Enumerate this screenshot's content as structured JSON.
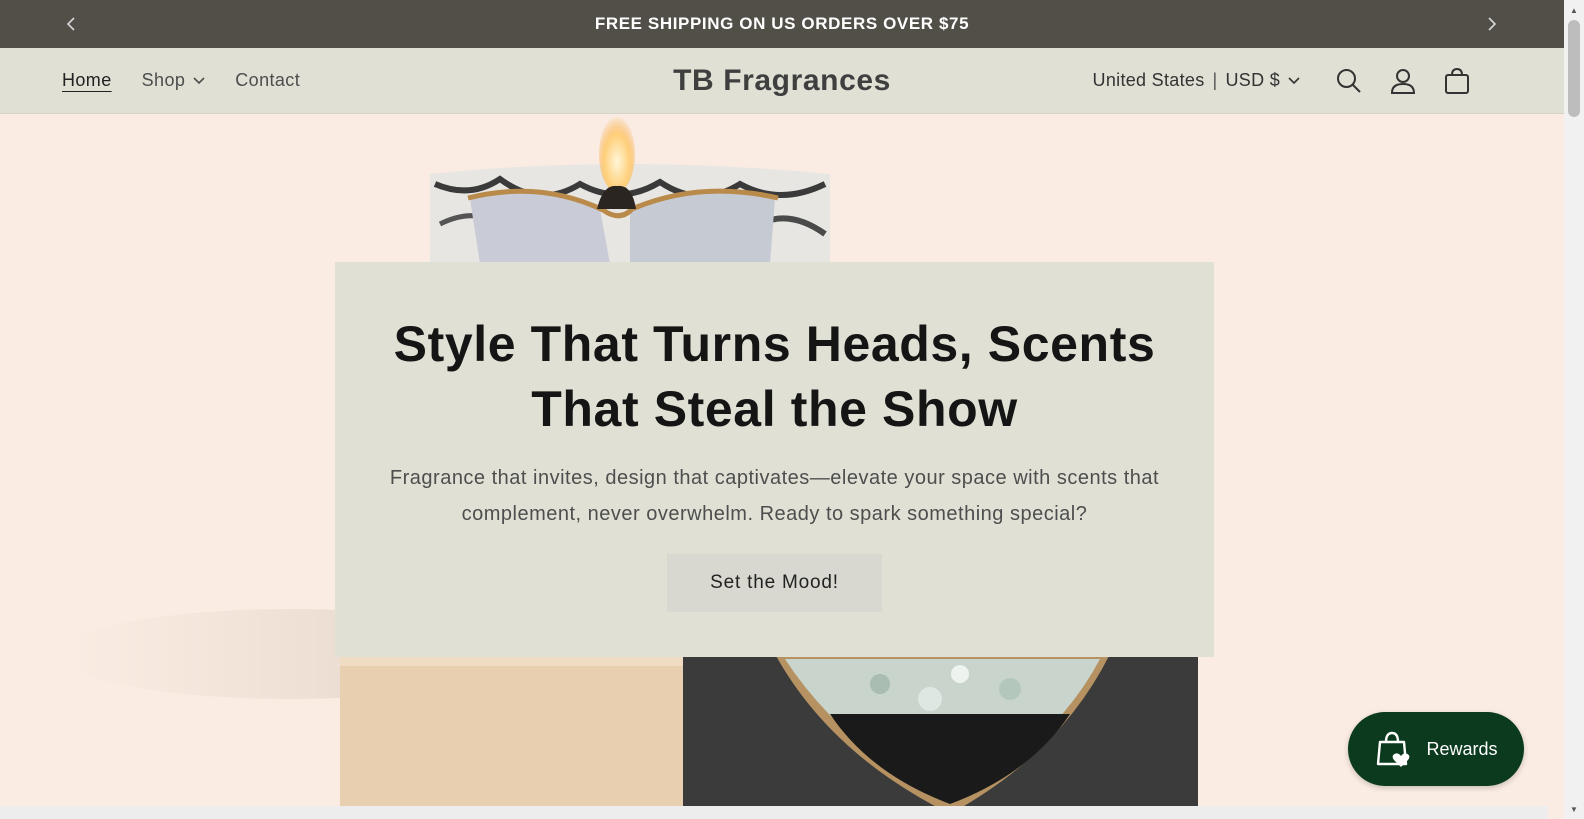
{
  "announcement": {
    "text": "FREE SHIPPING ON US ORDERS OVER $75",
    "prev_icon": "chevron-left-icon",
    "next_icon": "chevron-right-icon"
  },
  "header": {
    "brand": "TB Fragrances",
    "nav": [
      {
        "label": "Home"
      },
      {
        "label": "Shop"
      },
      {
        "label": "Contact"
      }
    ],
    "locale": {
      "country": "United States",
      "separator": "|",
      "currency": "USD $"
    },
    "icons": [
      "search-icon",
      "account-icon",
      "cart-icon"
    ]
  },
  "hero": {
    "title": "Style That Turns Heads, Scents That Steal the Show",
    "subtitle": "Fragrance that invites, design that captivates—elevate your space with scents that complement, never overwhelm. Ready to spark something special?",
    "cta_label": "Set the Mood!"
  },
  "rewards": {
    "label": "Rewards",
    "icon": "shopping-bag-heart-icon"
  },
  "colors": {
    "announcement_bg": "#524f49",
    "header_bg": "#e0e0d5",
    "hero_bg": "#faece2",
    "rewards_bg": "#0c3a1f"
  }
}
